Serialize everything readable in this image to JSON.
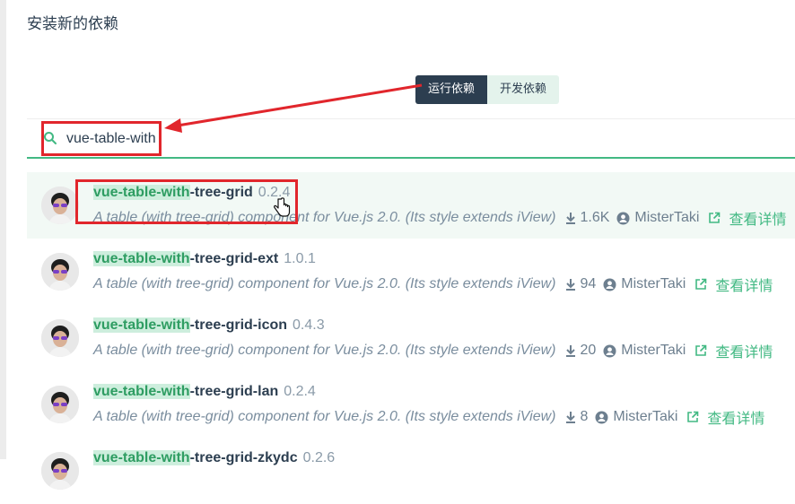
{
  "page": {
    "title": "安装新的依赖"
  },
  "dependency_tabs": {
    "runtime": "运行依赖",
    "dev": "开发依赖",
    "active": "runtime"
  },
  "search": {
    "value": "vue-table-with",
    "icon": "search-icon"
  },
  "results": [
    {
      "highlight": "vue-table-with",
      "rest": "-tree-grid",
      "version": "0.2.4",
      "description": "A table (with tree-grid) component for Vue.js 2.0. (Its style extends iView)",
      "downloads": "1.6K",
      "author": "MisterTaki",
      "details": "查看详情",
      "hovered": true
    },
    {
      "highlight": "vue-table-with",
      "rest": "-tree-grid-ext",
      "version": "1.0.1",
      "description": "A table (with tree-grid) component for Vue.js 2.0. (Its style extends iView)",
      "downloads": "94",
      "author": "MisterTaki",
      "details": "查看详情",
      "hovered": false
    },
    {
      "highlight": "vue-table-with",
      "rest": "-tree-grid-icon",
      "version": "0.4.3",
      "description": "A table (with tree-grid) component for Vue.js 2.0. (Its style extends iView)",
      "downloads": "20",
      "author": "MisterTaki",
      "details": "查看详情",
      "hovered": false
    },
    {
      "highlight": "vue-table-with",
      "rest": "-tree-grid-lan",
      "version": "0.2.4",
      "description": "A table (with tree-grid) component for Vue.js 2.0. (Its style extends iView)",
      "downloads": "8",
      "author": "MisterTaki",
      "details": "查看详情",
      "hovered": false
    },
    {
      "highlight": "vue-table-with",
      "rest": "-tree-grid-zkydc",
      "version": "0.2.6",
      "description": "",
      "downloads": "",
      "author": "",
      "details": "",
      "hovered": false
    }
  ],
  "colors": {
    "accent": "#42b983",
    "annotation": "#e1262c",
    "dark": "#2c3e50"
  }
}
